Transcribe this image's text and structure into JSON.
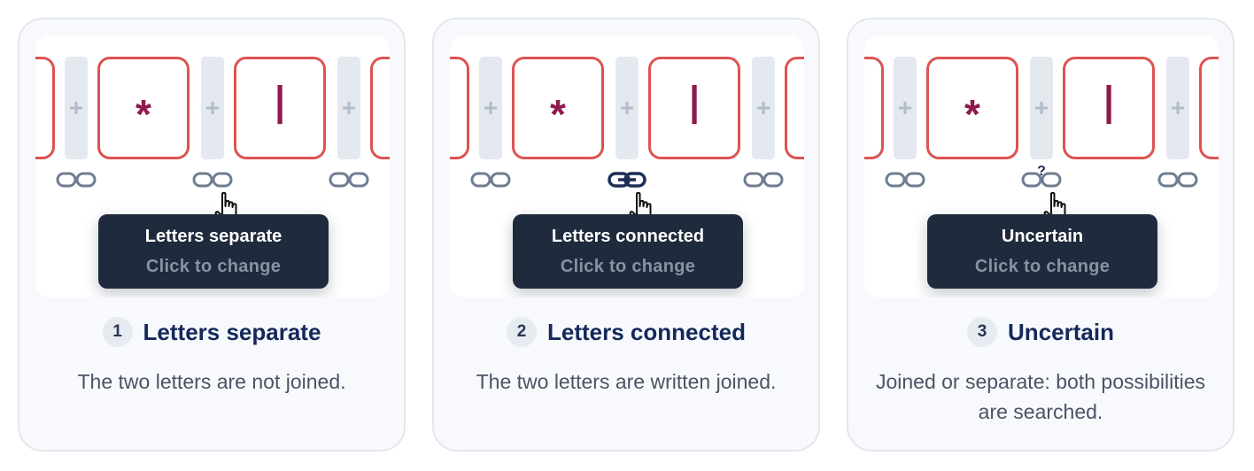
{
  "glyphs": {
    "star": "*",
    "alif": "ا",
    "plus": "+"
  },
  "link_colors": {
    "inactive": "#6f7d92",
    "active": "#1e2e55"
  },
  "cards": [
    {
      "id": "separate",
      "link_state": "separate",
      "tooltip_title": "Letters separate",
      "tooltip_sub": "Click to change",
      "step_number": "1",
      "title": "Letters separate",
      "description": "The two letters are not joined."
    },
    {
      "id": "connected",
      "link_state": "connected",
      "tooltip_title": "Letters connected",
      "tooltip_sub": "Click to change",
      "step_number": "2",
      "title": "Letters connected",
      "description": "The two letters are written joined."
    },
    {
      "id": "uncertain",
      "link_state": "uncertain",
      "uncertain_mark": "?",
      "tooltip_title": "Uncertain",
      "tooltip_sub": "Click to change",
      "step_number": "3",
      "title": "Uncertain",
      "description": "Joined or separate: both possibilities are searched."
    }
  ]
}
